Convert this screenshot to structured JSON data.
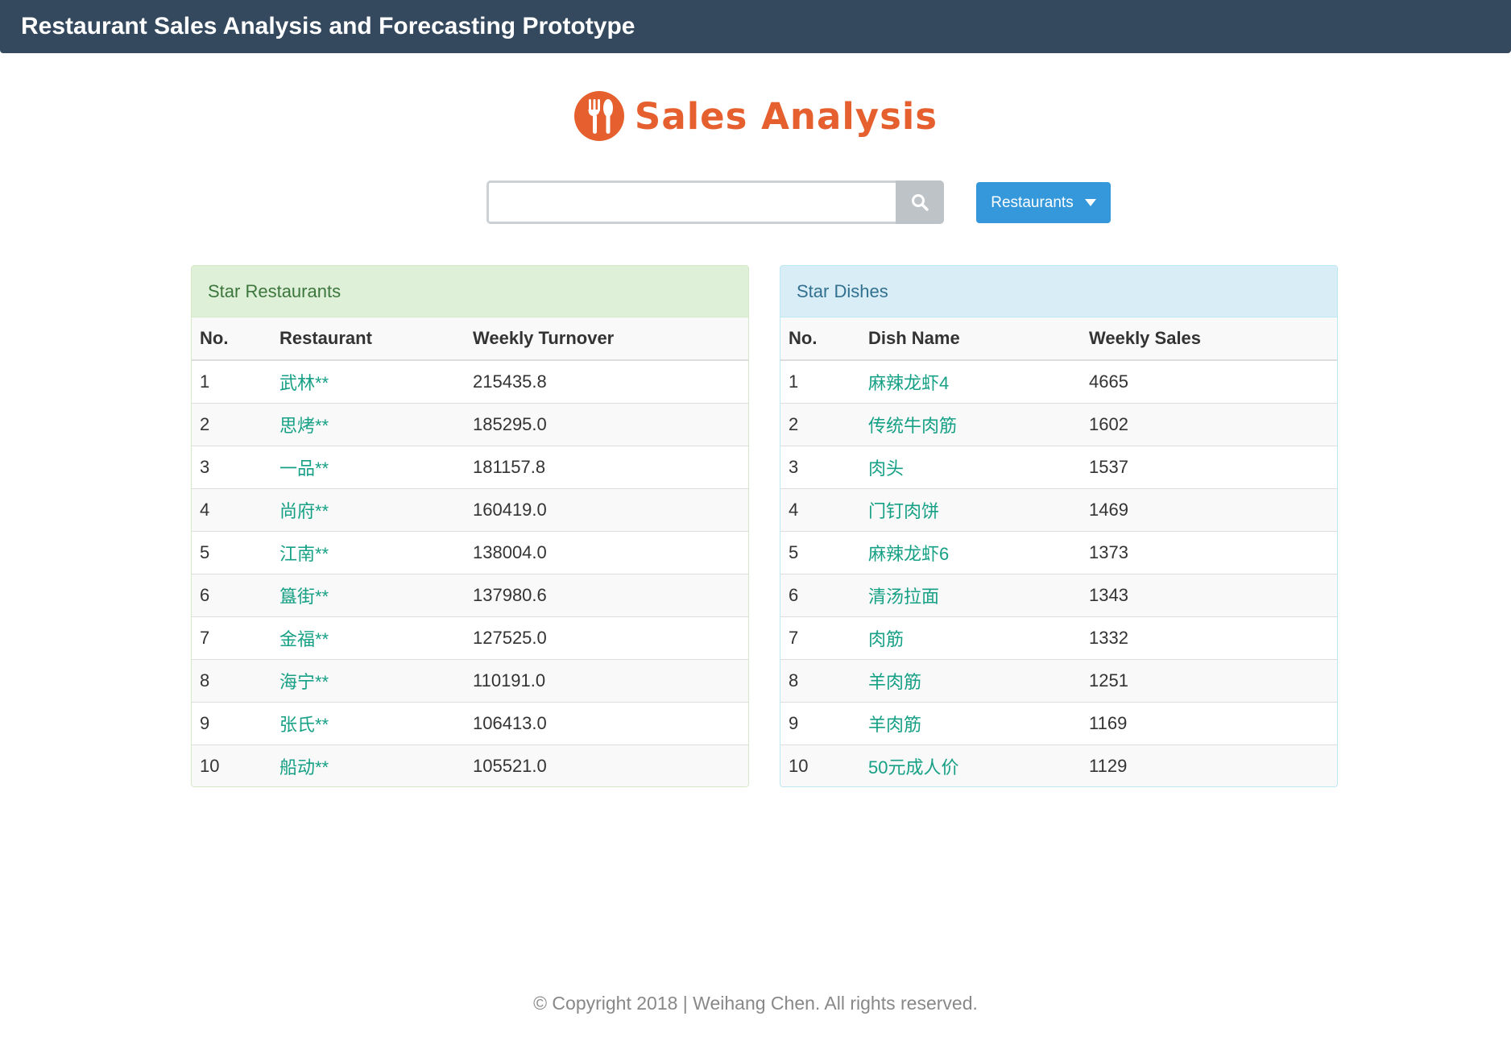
{
  "navbar": {
    "title": "Restaurant Sales Analysis and Forecasting Prototype"
  },
  "logo": {
    "text": "Sales Analysis",
    "color": "#e5602e",
    "icon": "fork-spoon-icon"
  },
  "search": {
    "value": "",
    "placeholder": "",
    "button_icon": "search-icon"
  },
  "dropdown": {
    "label": "Restaurants",
    "icon": "caret-down-icon"
  },
  "star_restaurants": {
    "heading": "Star Restaurants",
    "columns": [
      "No.",
      "Restaurant",
      "Weekly Turnover"
    ],
    "rows": [
      {
        "no": "1",
        "name": "武林**",
        "value": "215435.8"
      },
      {
        "no": "2",
        "name": "思烤**",
        "value": "185295.0"
      },
      {
        "no": "3",
        "name": "一品**",
        "value": "181157.8"
      },
      {
        "no": "4",
        "name": "尚府**",
        "value": "160419.0"
      },
      {
        "no": "5",
        "name": "江南**",
        "value": "138004.0"
      },
      {
        "no": "6",
        "name": "簋街**",
        "value": "137980.6"
      },
      {
        "no": "7",
        "name": "金福**",
        "value": "127525.0"
      },
      {
        "no": "8",
        "name": "海宁**",
        "value": "110191.0"
      },
      {
        "no": "9",
        "name": "张氏**",
        "value": "106413.0"
      },
      {
        "no": "10",
        "name": "船动**",
        "value": "105521.0"
      }
    ]
  },
  "star_dishes": {
    "heading": "Star Dishes",
    "columns": [
      "No.",
      "Dish Name",
      "Weekly Sales"
    ],
    "rows": [
      {
        "no": "1",
        "name": "麻辣龙虾4",
        "value": "4665"
      },
      {
        "no": "2",
        "name": "传统牛肉筋",
        "value": "1602"
      },
      {
        "no": "3",
        "name": "肉头",
        "value": "1537"
      },
      {
        "no": "4",
        "name": "门钉肉饼",
        "value": "1469"
      },
      {
        "no": "5",
        "name": "麻辣龙虾6",
        "value": "1373"
      },
      {
        "no": "6",
        "name": "清汤拉面",
        "value": "1343"
      },
      {
        "no": "7",
        "name": "肉筋",
        "value": "1332"
      },
      {
        "no": "8",
        "name": "羊肉筋",
        "value": "1251"
      },
      {
        "no": "9",
        "name": "羊肉筋",
        "value": "1169"
      },
      {
        "no": "10",
        "name": "50元成人价",
        "value": "1129"
      }
    ]
  },
  "footer": {
    "text": "© Copyright 2018  |  Weihang Chen. All rights reserved."
  }
}
